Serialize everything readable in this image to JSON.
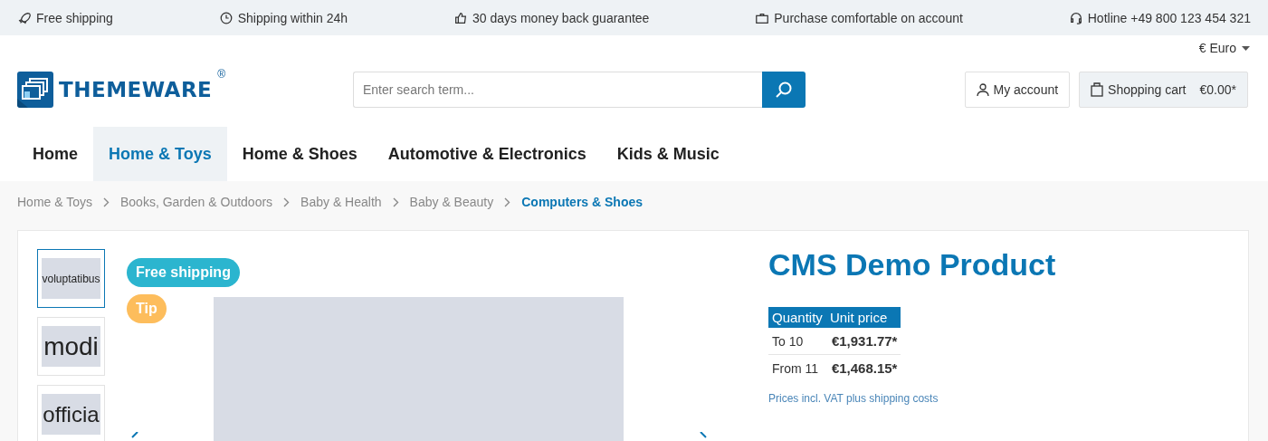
{
  "top_bar": {
    "items": [
      {
        "label": "Free shipping"
      },
      {
        "label": "Shipping within 24h"
      },
      {
        "label": "30 days money back guarantee"
      },
      {
        "label": "Purchase comfortable on account"
      },
      {
        "label": "Hotline +49 800 123 454 321"
      }
    ]
  },
  "currency": {
    "label": "€ Euro"
  },
  "header": {
    "logo": "THEMEWARE",
    "logo_mark": "®",
    "search": {
      "placeholder": "Enter search term..."
    },
    "account": "My account",
    "cart": {
      "label": "Shopping cart",
      "total": "€0.00*"
    }
  },
  "nav": {
    "items": [
      {
        "label": "Home",
        "selected": false
      },
      {
        "label": "Home & Toys",
        "selected": true
      },
      {
        "label": "Home & Shoes",
        "selected": false
      },
      {
        "label": "Automotive & Electronics",
        "selected": false
      },
      {
        "label": "Kids & Music",
        "selected": false
      }
    ]
  },
  "breadcrumb": [
    {
      "label": "Home & Toys",
      "selected": false
    },
    {
      "label": "Books, Garden & Outdoors",
      "selected": false
    },
    {
      "label": "Baby & Health",
      "selected": false
    },
    {
      "label": "Baby & Beauty",
      "selected": false
    },
    {
      "label": "Computers & Shoes",
      "selected": true
    }
  ],
  "product": {
    "thumbnails": [
      {
        "text": "voluptatibus",
        "selected": true
      },
      {
        "text": "modi",
        "selected": false
      },
      {
        "text": "officia",
        "selected": false
      }
    ],
    "badges": [
      {
        "label": "Free shipping",
        "color": "#2bb5cf"
      },
      {
        "label": "Tip",
        "color": "#fdbd5c"
      }
    ],
    "title": "CMS Demo Product",
    "price_table": {
      "columns": [
        "Quantity",
        "Unit price"
      ],
      "rows": [
        [
          "To 10",
          "€1,931.77*"
        ],
        [
          "From 11",
          "€1,468.15*"
        ]
      ]
    },
    "tax_note": "Prices incl. VAT plus shipping costs"
  }
}
